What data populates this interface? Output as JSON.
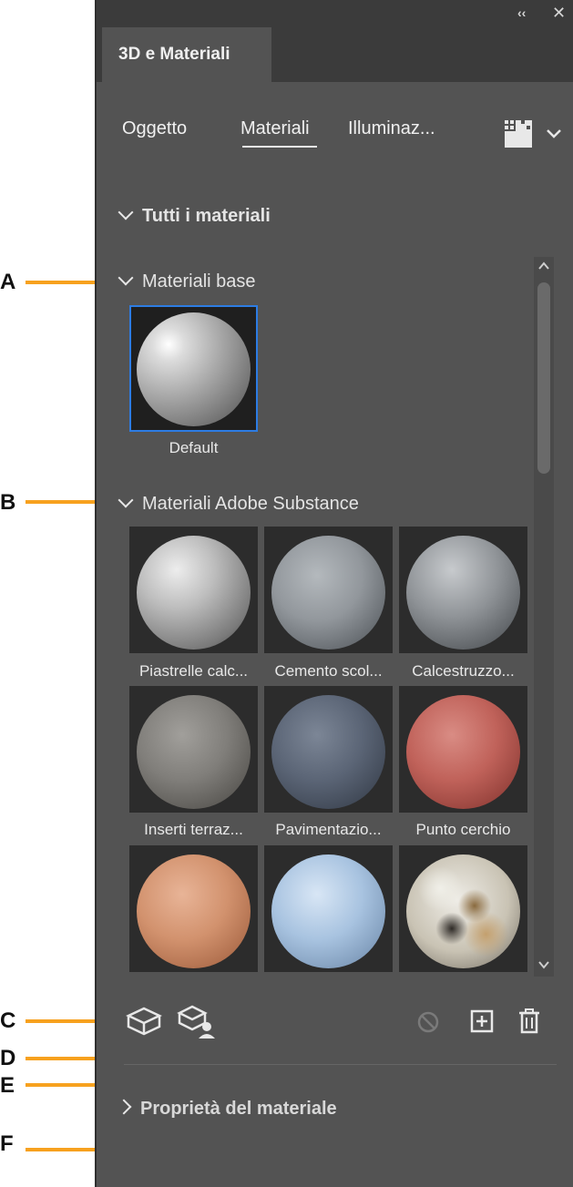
{
  "callouts": [
    "A",
    "B",
    "C",
    "D",
    "E",
    "F"
  ],
  "panel": {
    "tab_title": "3D e Materiali",
    "collapse_glyph": "‹‹",
    "close_glyph": "✕",
    "subtabs": [
      "Oggetto",
      "Materiali",
      "Illuminaz..."
    ],
    "active_subtab": "Materiali"
  },
  "sections": {
    "all": "Tutti i materiali",
    "base": "Materiali base",
    "substance": "Materiali Adobe Substance",
    "properties": "Proprietà del materiale"
  },
  "base_materials": [
    {
      "label": "Default",
      "selected": true
    }
  ],
  "substance_materials": [
    {
      "label": "Piastrelle calc..."
    },
    {
      "label": "Cemento scol..."
    },
    {
      "label": "Calcestruzzo..."
    },
    {
      "label": "Inserti terraz..."
    },
    {
      "label": "Pavimentazio..."
    },
    {
      "label": "Punto cerchio"
    },
    {
      "label": ""
    },
    {
      "label": ""
    },
    {
      "label": ""
    }
  ],
  "colors": {
    "panel_bg": "#535353",
    "header_bg": "#3b3b3b",
    "selection": "#2d7ce3",
    "callout": "#f7a11e"
  },
  "icons": {
    "scroll_up": "⌃",
    "scroll_down": "⌄"
  }
}
